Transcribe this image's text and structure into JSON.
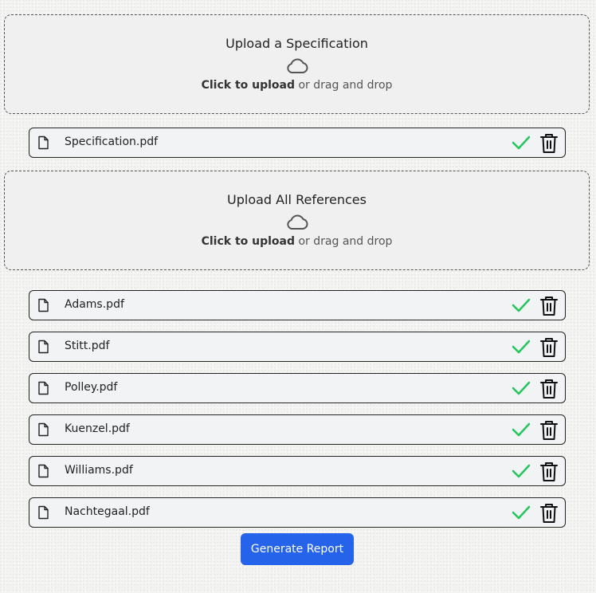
{
  "spec_upload": {
    "title": "Upload a Specification",
    "hint_bold": "Click to upload",
    "hint_rest": "or drag and drop",
    "icon": "cloud-icon"
  },
  "spec_files": [
    {
      "name": "Specification.pdf",
      "status": "uploaded"
    }
  ],
  "refs_upload": {
    "title": "Upload All References",
    "hint_bold": "Click to upload",
    "hint_rest": "or drag and drop",
    "icon": "cloud-icon"
  },
  "ref_files": [
    {
      "name": "Adams.pdf",
      "status": "uploaded"
    },
    {
      "name": "Stitt.pdf",
      "status": "uploaded"
    },
    {
      "name": "Polley.pdf",
      "status": "uploaded"
    },
    {
      "name": "Kuenzel.pdf",
      "status": "uploaded"
    },
    {
      "name": "Williams.pdf",
      "status": "uploaded"
    },
    {
      "name": "Nachtegaal.pdf",
      "status": "uploaded"
    }
  ],
  "actions": {
    "generate_label": "Generate Report"
  },
  "colors": {
    "accent": "#2563eb",
    "success": "#22c55e",
    "border": "#222222"
  }
}
